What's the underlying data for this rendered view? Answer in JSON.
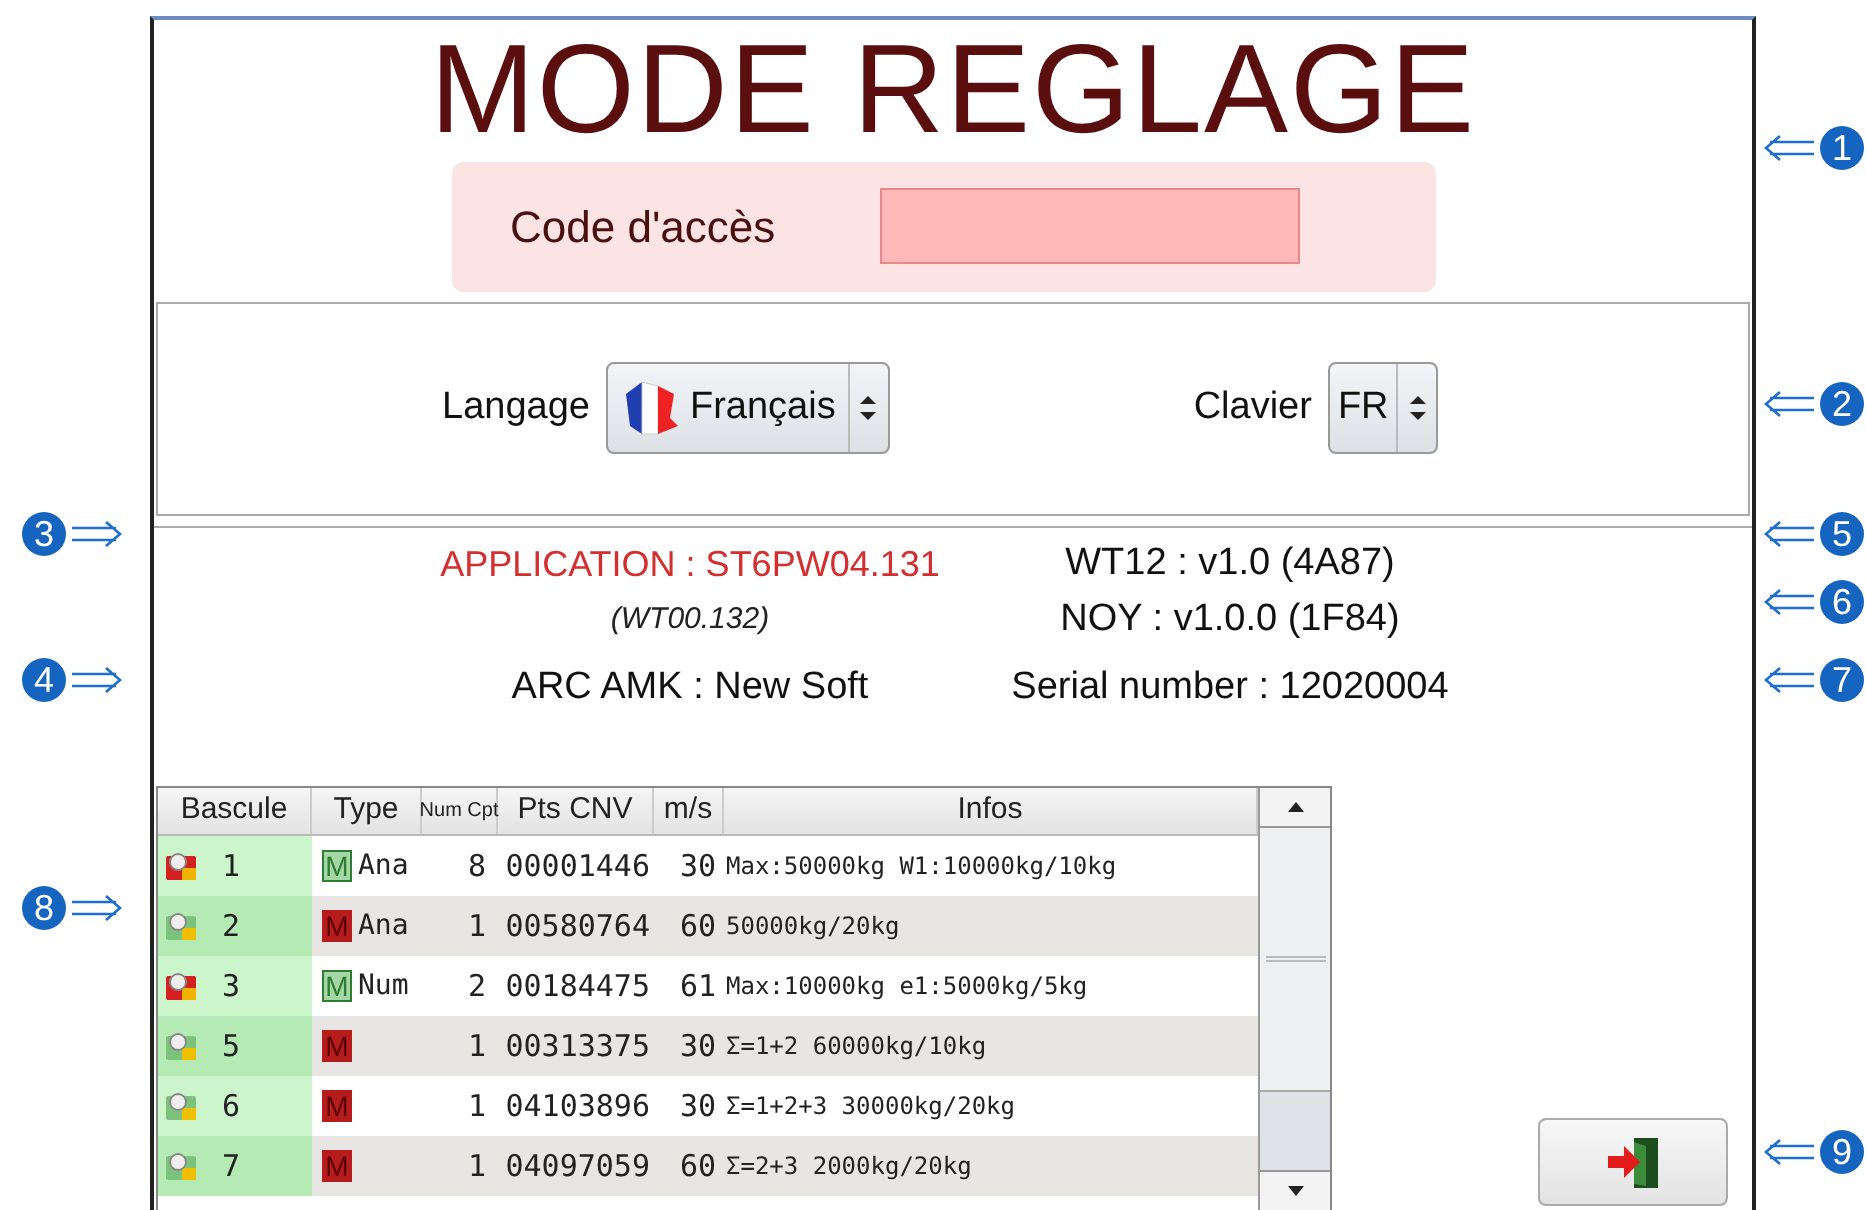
{
  "title": "MODE REGLAGE",
  "access_code": {
    "label": "Code d'accès"
  },
  "language": {
    "label": "Langage",
    "value": "Français"
  },
  "keyboard": {
    "label": "Clavier",
    "value": "FR"
  },
  "info": {
    "application": "APPLICATION : ST6PW04.131",
    "application_sub": "(WT00.132)",
    "arc": "ARC AMK : New Soft",
    "wt12": "WT12 : v1.0 (4A87)",
    "noy": "NOY : v1.0.0 (1F84)",
    "serial": "Serial number : 12020004"
  },
  "table": {
    "columns": [
      "Bascule",
      "Type",
      "Num Cpt",
      "Pts CNV",
      "m/s",
      "Infos"
    ],
    "rows": [
      {
        "kind": "alarm",
        "bascule": "1",
        "mark": {
          "label": "M",
          "color": "#2e7d32"
        },
        "type": "Ana",
        "num_cpt": "8",
        "pts_cnv": "00001446",
        "ms": "30",
        "infos": "Max:50000kg W1:10000kg/10kg"
      },
      {
        "kind": "ok",
        "bascule": "2",
        "mark": {
          "label": "M",
          "color": "#b71c1c"
        },
        "type": "Ana",
        "num_cpt": "1",
        "pts_cnv": "00580764",
        "ms": "60",
        "infos": "50000kg/20kg"
      },
      {
        "kind": "alarm",
        "bascule": "3",
        "mark": {
          "label": "M",
          "color": "#2e7d32"
        },
        "type": "Num",
        "num_cpt": "2",
        "pts_cnv": "00184475",
        "ms": "61",
        "infos": "Max:10000kg e1:5000kg/5kg"
      },
      {
        "kind": "ok",
        "bascule": "5",
        "mark": {
          "label": "M",
          "color": "#b71c1c"
        },
        "type": "",
        "num_cpt": "1",
        "pts_cnv": "00313375",
        "ms": "30",
        "infos": "Σ=1+2 60000kg/10kg"
      },
      {
        "kind": "ok",
        "bascule": "6",
        "mark": {
          "label": "M",
          "color": "#b71c1c"
        },
        "type": "",
        "num_cpt": "1",
        "pts_cnv": "04103896",
        "ms": "30",
        "infos": "Σ=1+2+3 30000kg/20kg"
      },
      {
        "kind": "ok",
        "bascule": "7",
        "mark": {
          "label": "M",
          "color": "#b71c1c"
        },
        "type": "",
        "num_cpt": "1",
        "pts_cnv": "04097059",
        "ms": "60",
        "infos": "Σ=2+3 2000kg/20kg"
      }
    ]
  },
  "callouts": [
    {
      "number": "1",
      "kind": "right"
    },
    {
      "number": "2",
      "kind": "right"
    },
    {
      "number": "3",
      "kind": "left"
    },
    {
      "number": "5",
      "kind": "right"
    },
    {
      "number": "6",
      "kind": "right"
    },
    {
      "number": "4",
      "kind": "left"
    },
    {
      "number": "7",
      "kind": "right"
    },
    {
      "number": "8",
      "kind": "left"
    },
    {
      "number": "9",
      "kind": "right"
    }
  ]
}
